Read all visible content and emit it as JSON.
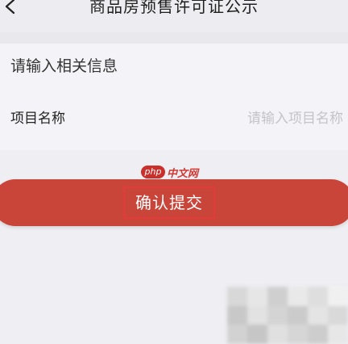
{
  "header": {
    "title": "商品房预售许可证公示",
    "back_icon": "chevron-left-icon"
  },
  "form": {
    "section_title": "请输入相关信息",
    "project_name": {
      "label": "项目名称",
      "placeholder": "请输入项目名称",
      "value": ""
    }
  },
  "watermark": {
    "logo_text": "php",
    "text": "中文网"
  },
  "submit": {
    "label": "确认提交",
    "color": "#c9453a"
  }
}
